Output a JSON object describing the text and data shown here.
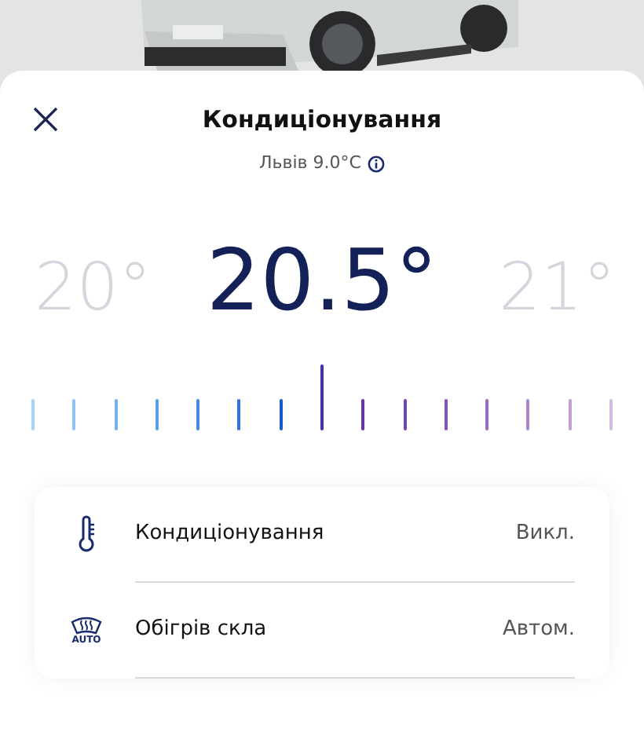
{
  "header": {
    "title": "Кондиціонування",
    "location": "Львів 9.0°C"
  },
  "temperature": {
    "previous": "20°",
    "current": "20.5°",
    "next": "21°"
  },
  "scale": {
    "ticks": [
      {
        "color": "#a9d3f5",
        "selected": false
      },
      {
        "color": "#8fc2f2",
        "selected": false
      },
      {
        "color": "#74b0ee",
        "selected": false
      },
      {
        "color": "#5b9de9",
        "selected": false
      },
      {
        "color": "#4589e3",
        "selected": false
      },
      {
        "color": "#2f72dd",
        "selected": false
      },
      {
        "color": "#1c58d2",
        "selected": false
      },
      {
        "color": "#4a2ea6",
        "selected": true
      },
      {
        "color": "#6236a6",
        "selected": false
      },
      {
        "color": "#7244ae",
        "selected": false
      },
      {
        "color": "#8355b6",
        "selected": false
      },
      {
        "color": "#9a6cc0",
        "selected": false
      },
      {
        "color": "#ae86c9",
        "selected": false
      },
      {
        "color": "#c19fd2",
        "selected": false
      },
      {
        "color": "#d4badd",
        "selected": false
      }
    ]
  },
  "settings": [
    {
      "kind": "thermometer",
      "label": "Кондиціонування",
      "value": "Викл."
    },
    {
      "kind": "defrost",
      "icon_label": "AUTO",
      "label": "Обігрів скла",
      "value": "Автом."
    }
  ]
}
